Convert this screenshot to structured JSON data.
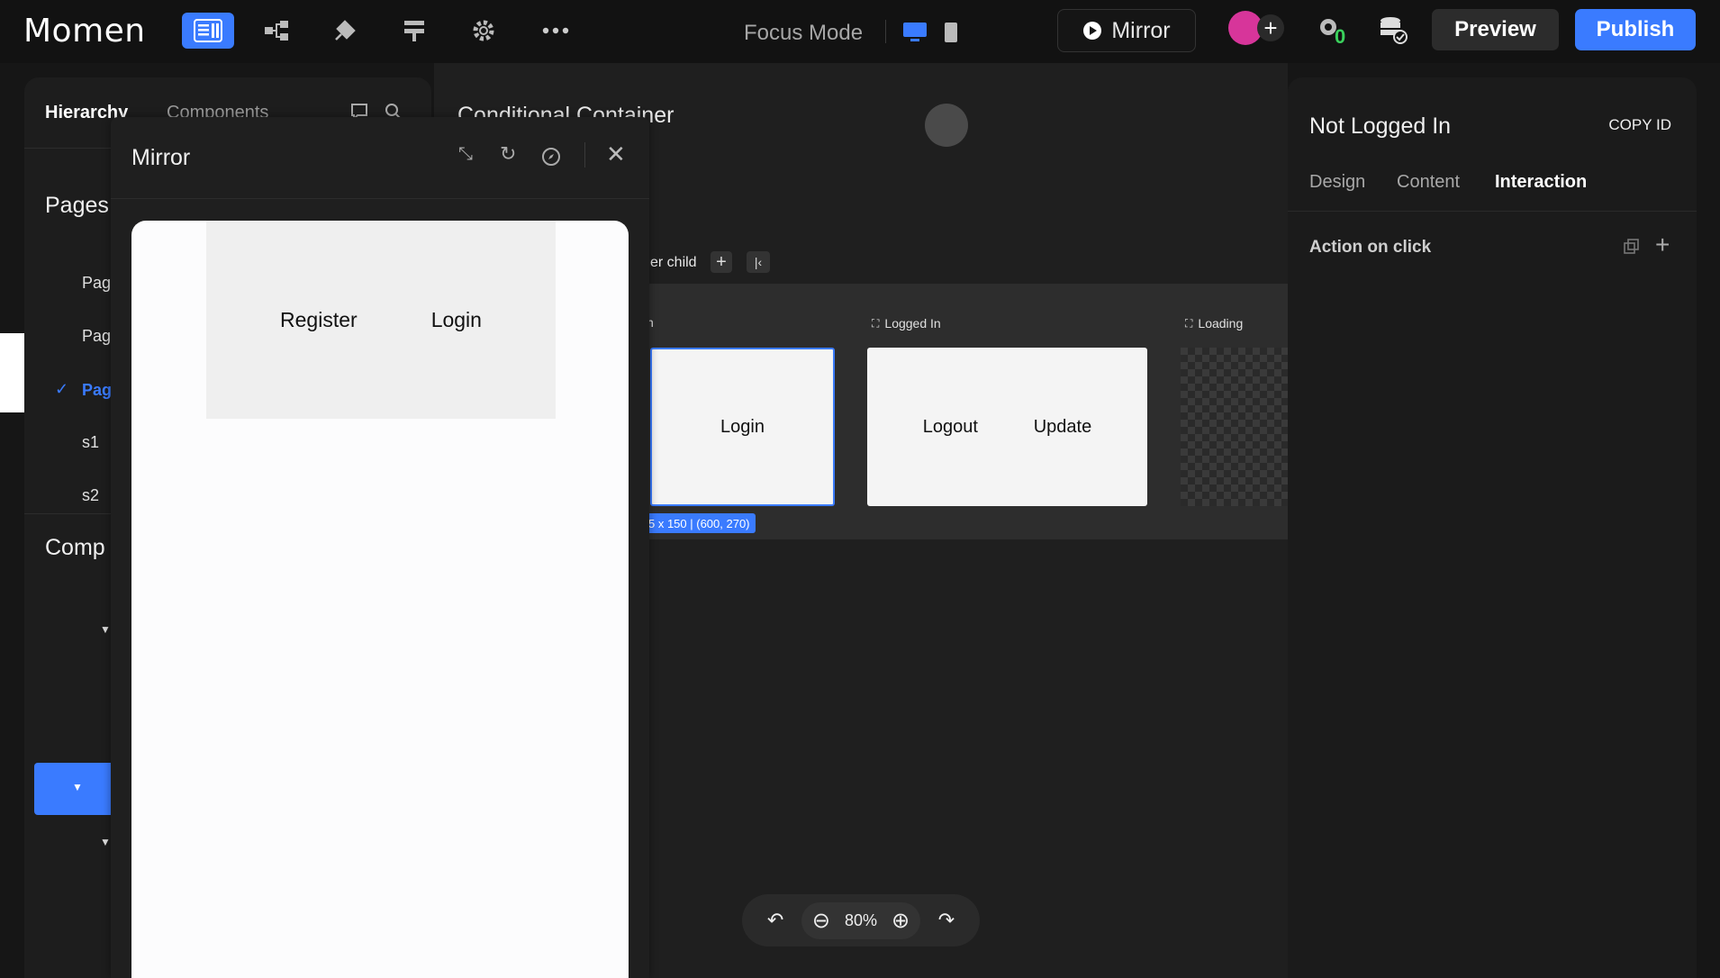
{
  "topbar": {
    "logo_text": "Momen",
    "focus_mode": "Focus Mode",
    "mirror_label": "Mirror",
    "preview_label": "Preview",
    "publish_label": "Publish",
    "debug_badge": "0",
    "accent_color": "#3a7bff"
  },
  "left_panel": {
    "tabs": [
      "Hierarchy",
      "Components"
    ],
    "pages_title": "Pages",
    "pages": [
      "Pag",
      "Pag",
      "Pag",
      "s1",
      "s2"
    ],
    "components_title": "Comp"
  },
  "canvas": {
    "breadcrumb": "Conditional Container",
    "child_label": "er child",
    "views": [
      {
        "label": "n",
        "buttons": [
          "Login"
        ]
      },
      {
        "label": "Logged In",
        "buttons": [
          "Logout",
          "Update"
        ]
      },
      {
        "label": "Loading",
        "buttons": []
      }
    ],
    "size_tag": "5 x 150 | (600, 270)"
  },
  "zoom": {
    "level": "80%"
  },
  "right_panel": {
    "title": "Not Logged In",
    "copy_id": "COPY ID",
    "tabs": [
      "Design",
      "Content",
      "Interaction"
    ],
    "active_tab": "Interaction",
    "action_on_click": "Action on click"
  },
  "mirror_panel": {
    "title": "Mirror",
    "preview_buttons": [
      "Register",
      "Login"
    ]
  }
}
